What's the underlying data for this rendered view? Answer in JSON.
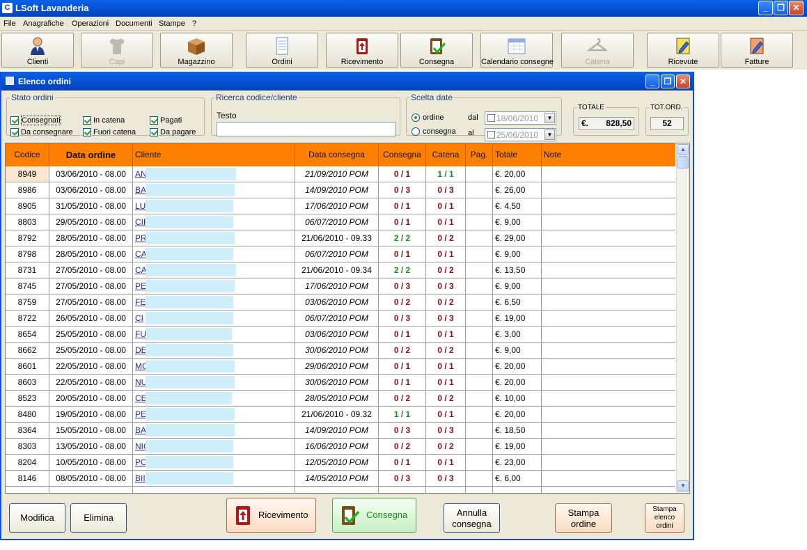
{
  "app": {
    "title": "LSoft Lavanderia",
    "icon_glyph": "C",
    "window_controls": {
      "minimize": "_",
      "maximize": "❐",
      "close": "✕"
    }
  },
  "menu": [
    "File",
    "Anagrafiche",
    "Operazioni",
    "Documenti",
    "Stampe",
    "?"
  ],
  "toolbar": [
    {
      "label": "Clienti",
      "icon": "person-icon",
      "enabled": true
    },
    {
      "label": "Capi",
      "icon": "shirt-icon",
      "enabled": false
    },
    {
      "label": "Magazzino",
      "icon": "box-icon",
      "enabled": true
    },
    {
      "label": "Ordini",
      "icon": "notepad-icon",
      "enabled": true
    },
    {
      "label": "Ricevimento",
      "icon": "clipboard-in-icon",
      "enabled": true
    },
    {
      "label": "Consegna",
      "icon": "clipboard-check-icon",
      "enabled": true
    },
    {
      "label": "Calendario consegne",
      "icon": "calendar-icon",
      "enabled": true
    },
    {
      "label": "Catena",
      "icon": "hanger-icon",
      "enabled": false
    },
    {
      "label": "Ricevute",
      "icon": "receipt-pen-icon",
      "enabled": true
    },
    {
      "label": "Fatture",
      "icon": "invoice-pen-icon",
      "enabled": true
    }
  ],
  "child": {
    "title": "Elenco ordini",
    "stato": {
      "legend": "Stato ordini",
      "checks": [
        {
          "label": "Consegnati",
          "checked": true
        },
        {
          "label": "In catena",
          "checked": true
        },
        {
          "label": "Pagati",
          "checked": true
        },
        {
          "label": "Da consegnare",
          "checked": true
        },
        {
          "label": "Fuori catena",
          "checked": true
        },
        {
          "label": "Da pagare",
          "checked": true
        }
      ]
    },
    "ricerca": {
      "legend": "Ricerca codice/cliente",
      "label": "Testo",
      "value": ""
    },
    "date": {
      "legend": "Scelta date",
      "radio_ordine": "ordine",
      "radio_consegna": "consegna",
      "dal_label": "dal",
      "al_label": "al",
      "dal_value": "18/06/2010",
      "al_value": "25/06/2010",
      "dropdown_glyph": "▼"
    },
    "totale": {
      "label": "TOTALE",
      "currency": "€.",
      "value": "828,50"
    },
    "tot_ord": {
      "label": "TOT.ORD.",
      "value": "52"
    },
    "columns": [
      "Codice",
      "Data ordine",
      "Cliente",
      "Data consegna",
      "Consegna",
      "Catena",
      "Pag.",
      "Totale",
      "Note"
    ],
    "rows": [
      {
        "code": "8949",
        "date": "03/06/2010 - 08.00",
        "client": "AN",
        "delivery": "21/09/2010 POM",
        "delivery_italic": true,
        "cons": "0 / 1",
        "cons_green": false,
        "cat": "1 / 1",
        "cat_green": true,
        "total": "€. 20,00"
      },
      {
        "code": "8986",
        "date": "03/06/2010 - 08.00",
        "client": "BA",
        "delivery": "14/09/2010 POM",
        "delivery_italic": true,
        "cons": "0 / 3",
        "cons_green": false,
        "cat": "0 / 3",
        "cat_green": false,
        "total": "€. 26,00"
      },
      {
        "code": "8905",
        "date": "31/05/2010 - 08.00",
        "client": "LU",
        "delivery": "17/06/2010 POM",
        "delivery_italic": true,
        "cons": "0 / 1",
        "cons_green": false,
        "cat": "0 / 1",
        "cat_green": false,
        "total": "€. 4,50"
      },
      {
        "code": "8803",
        "date": "29/05/2010 - 08.00",
        "client": "CIF",
        "delivery": "06/07/2010 POM",
        "delivery_italic": true,
        "cons": "0 / 1",
        "cons_green": false,
        "cat": "0 / 1",
        "cat_green": false,
        "total": "€. 9,00"
      },
      {
        "code": "8792",
        "date": "28/05/2010 - 08.00",
        "client": "PR",
        "delivery": "21/06/2010 - 09.33",
        "delivery_italic": false,
        "cons": "2 / 2",
        "cons_green": true,
        "cat": "0 / 2",
        "cat_green": false,
        "total": "€. 29,00"
      },
      {
        "code": "8798",
        "date": "28/05/2010 - 08.00",
        "client": "CA",
        "delivery": "06/07/2010 POM",
        "delivery_italic": true,
        "cons": "0 / 1",
        "cons_green": false,
        "cat": "0 / 1",
        "cat_green": false,
        "total": "€. 9,00"
      },
      {
        "code": "8731",
        "date": "27/05/2010 - 08.00",
        "client": "CA",
        "delivery": "21/06/2010 - 09.34",
        "delivery_italic": false,
        "cons": "2 / 2",
        "cons_green": true,
        "cat": "0 / 2",
        "cat_green": false,
        "total": "€. 13,50"
      },
      {
        "code": "8745",
        "date": "27/05/2010 - 08.00",
        "client": "PE",
        "delivery": "17/06/2010 POM",
        "delivery_italic": true,
        "cons": "0 / 3",
        "cons_green": false,
        "cat": "0 / 3",
        "cat_green": false,
        "total": "€. 9,00"
      },
      {
        "code": "8759",
        "date": "27/05/2010 - 08.00",
        "client": "FE",
        "delivery": "03/06/2010 POM",
        "delivery_italic": true,
        "cons": "0 / 2",
        "cons_green": false,
        "cat": "0 / 2",
        "cat_green": false,
        "total": "€. 6,50"
      },
      {
        "code": "8722",
        "date": "26/05/2010 - 08.00",
        "client": "CI",
        "delivery": "06/07/2010 POM",
        "delivery_italic": true,
        "cons": "0 / 3",
        "cons_green": false,
        "cat": "0 / 3",
        "cat_green": false,
        "total": "€. 19,00"
      },
      {
        "code": "8654",
        "date": "25/05/2010 - 08.00",
        "client": "FU",
        "delivery": "03/06/2010 POM",
        "delivery_italic": true,
        "cons": "0 / 1",
        "cons_green": false,
        "cat": "0 / 1",
        "cat_green": false,
        "total": "€. 3,00"
      },
      {
        "code": "8662",
        "date": "25/05/2010 - 08.00",
        "client": "DE",
        "delivery": "30/06/2010 POM",
        "delivery_italic": true,
        "cons": "0 / 2",
        "cons_green": false,
        "cat": "0 / 2",
        "cat_green": false,
        "total": "€. 9,00"
      },
      {
        "code": "8601",
        "date": "22/05/2010 - 08.00",
        "client": "MC",
        "delivery": "29/06/2010 POM",
        "delivery_italic": true,
        "cons": "0 / 1",
        "cons_green": false,
        "cat": "0 / 1",
        "cat_green": false,
        "total": "€. 20,00"
      },
      {
        "code": "8603",
        "date": "22/05/2010 - 08.00",
        "client": "NU",
        "delivery": "30/06/2010 POM",
        "delivery_italic": true,
        "cons": "0 / 1",
        "cons_green": false,
        "cat": "0 / 1",
        "cat_green": false,
        "total": "€. 20,00"
      },
      {
        "code": "8523",
        "date": "20/05/2010 - 08.00",
        "client": "CE",
        "delivery": "28/05/2010 POM",
        "delivery_italic": true,
        "cons": "0 / 2",
        "cons_green": false,
        "cat": "0 / 2",
        "cat_green": false,
        "total": "€. 10,00"
      },
      {
        "code": "8480",
        "date": "19/05/2010 - 08.00",
        "client": "PE",
        "delivery": "21/06/2010 - 09.32",
        "delivery_italic": false,
        "cons": "1 / 1",
        "cons_green": true,
        "cat": "0 / 1",
        "cat_green": false,
        "total": "€. 20,00"
      },
      {
        "code": "8364",
        "date": "15/05/2010 - 08.00",
        "client": "BA",
        "delivery": "14/09/2010 POM",
        "delivery_italic": true,
        "cons": "0 / 3",
        "cons_green": false,
        "cat": "0 / 3",
        "cat_green": false,
        "total": "€. 18,50"
      },
      {
        "code": "8303",
        "date": "13/05/2010 - 08.00",
        "client": "NIC",
        "delivery": "16/06/2010 POM",
        "delivery_italic": true,
        "cons": "0 / 2",
        "cons_green": false,
        "cat": "0 / 2",
        "cat_green": false,
        "total": "€. 19,00"
      },
      {
        "code": "8204",
        "date": "10/05/2010 - 08.00",
        "client": "PC",
        "delivery": "12/05/2010 POM",
        "delivery_italic": true,
        "cons": "0 / 1",
        "cons_green": false,
        "cat": "0 / 1",
        "cat_green": false,
        "total": "€. 23,00"
      },
      {
        "code": "8146",
        "date": "08/05/2010 - 08.00",
        "client": "BII",
        "delivery": "14/05/2010 POM",
        "delivery_italic": true,
        "cons": "0 / 3",
        "cons_green": false,
        "cat": "0 / 3",
        "cat_green": false,
        "total": "€. 6,00"
      }
    ],
    "scroll": {
      "up": "▲",
      "down": "▼"
    },
    "buttons": {
      "modifica": "Modifica",
      "elimina": "Elimina",
      "ricevimento": "Ricevimento",
      "consegna": "Consegna",
      "annulla_1": "Annulla",
      "annulla_2": "consegna",
      "stampa_ordine_1": "Stampa",
      "stampa_ordine_2": "ordine",
      "stampa_elenco_1": "Stampa",
      "stampa_elenco_2": "elenco",
      "stampa_elenco_3": "ordini"
    }
  }
}
